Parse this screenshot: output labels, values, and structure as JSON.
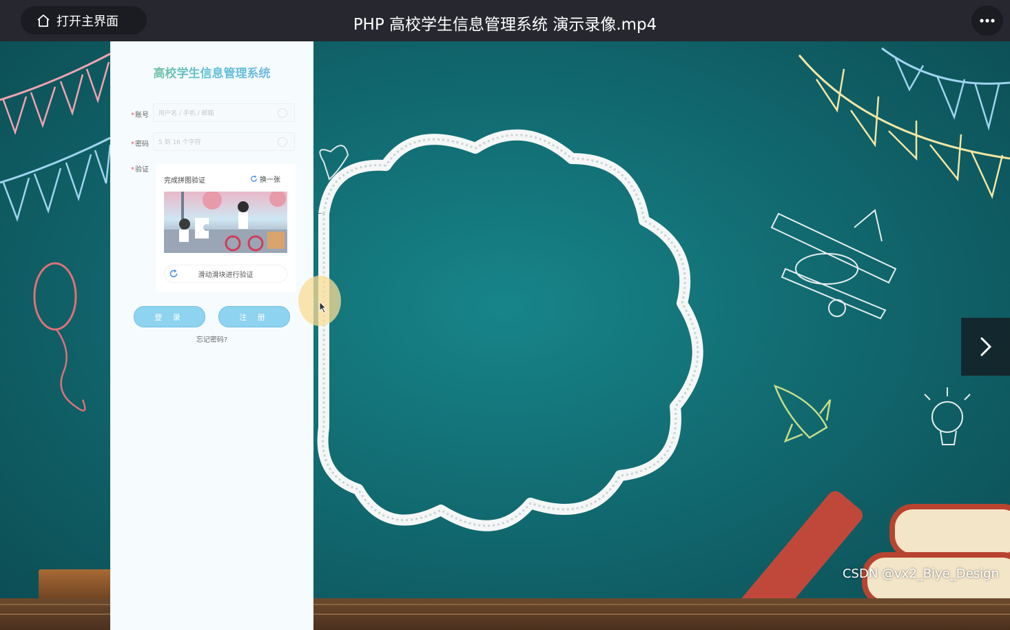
{
  "topbar": {
    "home_label": "打开主界面",
    "title": "PHP 高校学生信息管理系统 演示录像.mp4"
  },
  "login": {
    "system_title": "高校学生信息管理系统",
    "account_label": "账号",
    "account_placeholder": "用户名 / 手机 / 邮箱",
    "password_label": "密码",
    "password_placeholder": "5 到 16 个字符",
    "verify_label": "验证",
    "required_mark": "*",
    "captcha_title": "完成拼图验证",
    "captcha_refresh": "换一张",
    "slider_text": "滑动滑块进行验证",
    "login_button": "登 录",
    "register_button": "注 册",
    "forgot_link": "忘记密码?"
  },
  "watermark": "CSDN @vx2_Biye_Design",
  "colors": {
    "accent": "#8ed3ef",
    "background": "#116a70",
    "topbar": "#27282f"
  },
  "icons": [
    "home-icon",
    "more-icon",
    "refresh-icon",
    "next-icon",
    "cursor-icon"
  ]
}
